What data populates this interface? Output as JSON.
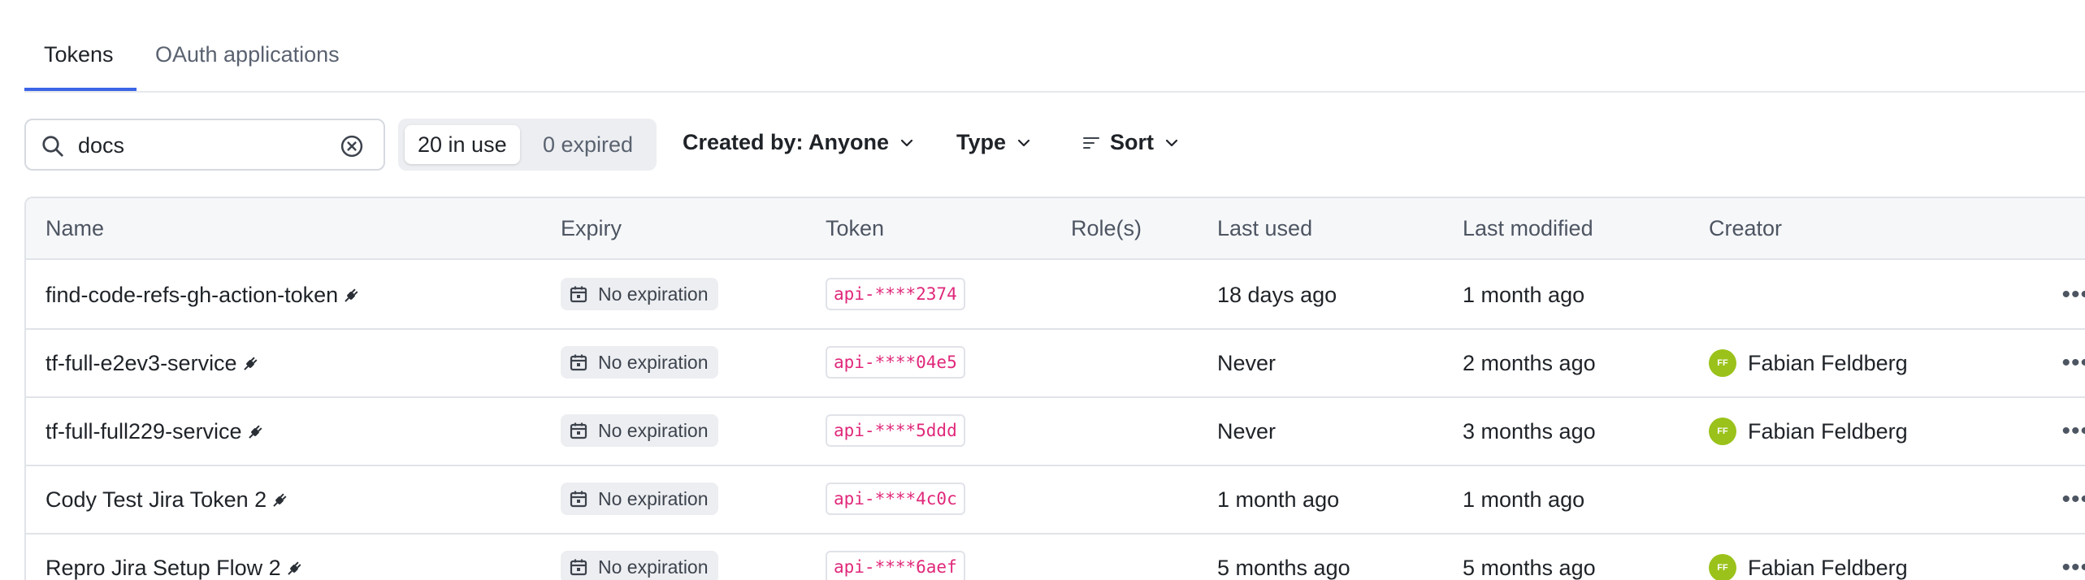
{
  "tabs": [
    {
      "label": "Tokens",
      "active": true
    },
    {
      "label": "OAuth applications",
      "active": false
    }
  ],
  "search": {
    "value": "docs",
    "placeholder": ""
  },
  "status_toggle": {
    "in_use": "20 in use",
    "expired": "0 expired"
  },
  "filters": {
    "created_by": "Created by: Anyone",
    "type": "Type",
    "sort": "Sort"
  },
  "table": {
    "headers": [
      "Name",
      "Expiry",
      "Token",
      "Role(s)",
      "Last used",
      "Last modified",
      "Creator"
    ],
    "rows": [
      {
        "name": "find-code-refs-gh-action-token",
        "expiry": "No expiration",
        "token": "api-****2374",
        "roles": "",
        "last_used": "18 days ago",
        "last_modified": "1 month ago",
        "creator": "",
        "creator_initials": ""
      },
      {
        "name": "tf-full-e2ev3-service",
        "expiry": "No expiration",
        "token": "api-****04e5",
        "roles": "",
        "last_used": "Never",
        "last_modified": "2 months ago",
        "creator": "Fabian Feldberg",
        "creator_initials": "FF"
      },
      {
        "name": "tf-full-full229-service",
        "expiry": "No expiration",
        "token": "api-****5ddd",
        "roles": "",
        "last_used": "Never",
        "last_modified": "3 months ago",
        "creator": "Fabian Feldberg",
        "creator_initials": "FF"
      },
      {
        "name": "Cody Test Jira Token 2",
        "expiry": "No expiration",
        "token": "api-****4c0c",
        "roles": "",
        "last_used": "1 month ago",
        "last_modified": "1 month ago",
        "creator": "",
        "creator_initials": ""
      },
      {
        "name": "Repro Jira Setup Flow 2",
        "expiry": "No expiration",
        "token": "api-****6aef",
        "roles": "",
        "last_used": "5 months ago",
        "last_modified": "5 months ago",
        "creator": "Fabian Feldberg",
        "creator_initials": "FF"
      }
    ]
  },
  "icons": {
    "search": "search-icon",
    "clear": "clear-circle-icon",
    "chevron": "chevron-down-icon",
    "sort": "sort-lines-icon",
    "calendar": "calendar-icon",
    "plug": "plug-icon",
    "more": "more-horizontal-icon"
  },
  "colors": {
    "accent": "#3b64e6",
    "token_text": "#e0287a",
    "avatar": "#9ac21a"
  }
}
